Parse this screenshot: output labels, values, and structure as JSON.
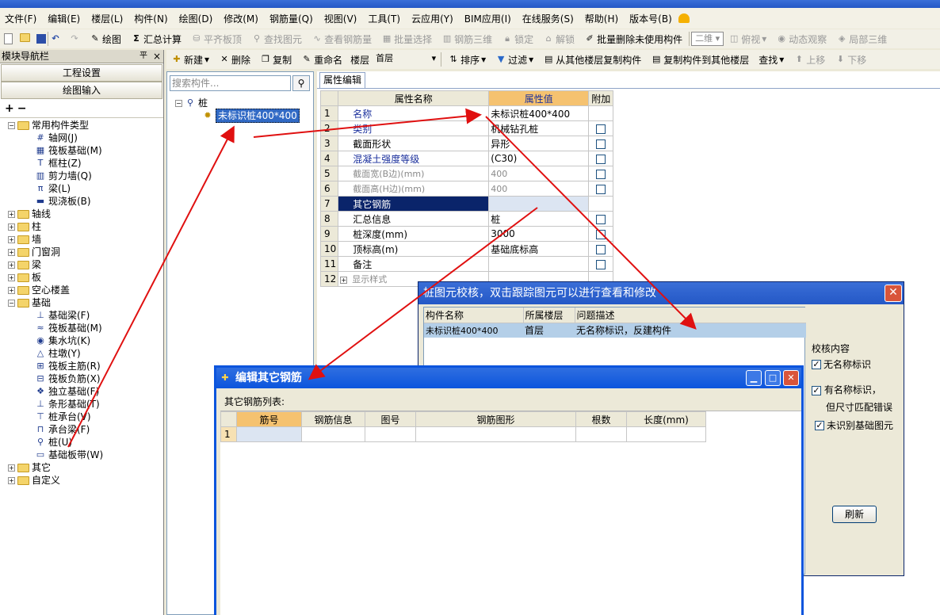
{
  "title_bar": {
    "text": ""
  },
  "menu": [
    "文件(F)",
    "编辑(E)",
    "楼层(L)",
    "构件(N)",
    "绘图(D)",
    "修改(M)",
    "钢筋量(Q)",
    "视图(V)",
    "工具(T)",
    "云应用(Y)",
    "BIM应用(I)",
    "在线服务(S)",
    "帮助(H)",
    "版本号(B)"
  ],
  "toolbar1": {
    "draw": "绘图",
    "sum_calc": "汇总计算",
    "flatten_slab": "平齐板顶",
    "find_element": "查找图元",
    "view_rebar": "查看钢筋量",
    "batch_select": "批量选择",
    "rebar_3d": "钢筋三维",
    "lock": "锁定",
    "unlock": "解锁",
    "batch_delete_unused": "批量删除未使用构件",
    "view_mode": "二维",
    "top_view": "俯视",
    "dynamic_observe": "动态观察",
    "local_3d": "局部三维"
  },
  "nav": {
    "title": "模块导航栏",
    "pin": "平",
    "close": "×",
    "project_settings": "工程设置",
    "drawing_input": "绘图输入",
    "tree": [
      {
        "label": "常用构件类型",
        "level": 0,
        "expanded": true
      },
      {
        "label": "轴网(J)",
        "level": 1
      },
      {
        "label": "筏板基础(M)",
        "level": 1
      },
      {
        "label": "框柱(Z)",
        "level": 1
      },
      {
        "label": "剪力墙(Q)",
        "level": 1
      },
      {
        "label": "梁(L)",
        "level": 1
      },
      {
        "label": "现浇板(B)",
        "level": 1
      },
      {
        "label": "轴线",
        "level": 0
      },
      {
        "label": "柱",
        "level": 0
      },
      {
        "label": "墙",
        "level": 0
      },
      {
        "label": "门窗洞",
        "level": 0
      },
      {
        "label": "梁",
        "level": 0
      },
      {
        "label": "板",
        "level": 0
      },
      {
        "label": "空心楼盖",
        "level": 0
      },
      {
        "label": "基础",
        "level": 0,
        "expanded": true
      },
      {
        "label": "基础梁(F)",
        "level": 1
      },
      {
        "label": "筏板基础(M)",
        "level": 1
      },
      {
        "label": "集水坑(K)",
        "level": 1
      },
      {
        "label": "柱墩(Y)",
        "level": 1
      },
      {
        "label": "筏板主筋(R)",
        "level": 1
      },
      {
        "label": "筏板负筋(X)",
        "level": 1
      },
      {
        "label": "独立基础(F)",
        "level": 1
      },
      {
        "label": "条形基础(T)",
        "level": 1
      },
      {
        "label": "桩承台(V)",
        "level": 1
      },
      {
        "label": "承台梁(F)",
        "level": 1
      },
      {
        "label": "桩(U)",
        "level": 1
      },
      {
        "label": "基础板带(W)",
        "level": 1
      },
      {
        "label": "其它",
        "level": 0
      },
      {
        "label": "自定义",
        "level": 0
      }
    ]
  },
  "toolbar2": {
    "new": "新建",
    "delete": "删除",
    "copy": "复制",
    "rename": "重命名",
    "floor_label": "楼层",
    "floor_value": "首层",
    "sort": "排序",
    "filter": "过滤",
    "copy_from_other": "从其他楼层复制构件",
    "copy_to_other": "复制构件到其他楼层",
    "find": "查找",
    "move_up": "上移",
    "move_down": "下移"
  },
  "component_list": {
    "search_placeholder": "搜索构件...",
    "root": "桩",
    "selected": "未标识桩400*400"
  },
  "property_editor": {
    "tab": "属性编辑",
    "headers": [
      "属性名称",
      "属性值",
      "附加"
    ],
    "rows": [
      {
        "num": "1",
        "name": "名称",
        "value": "未标识桩400*400",
        "check": false,
        "blue": true
      },
      {
        "num": "2",
        "name": "类别",
        "value": "机械钻孔桩",
        "check": true,
        "blue": true
      },
      {
        "num": "3",
        "name": "截面形状",
        "value": "异形",
        "check": true
      },
      {
        "num": "4",
        "name": "混凝土强度等级",
        "value": "(C30)",
        "check": true,
        "blue": true
      },
      {
        "num": "5",
        "name": "截面宽(B边)(mm)",
        "value": "400",
        "check": true,
        "gray": true
      },
      {
        "num": "6",
        "name": "截面高(H边)(mm)",
        "value": "400",
        "check": true,
        "gray": true
      },
      {
        "num": "7",
        "name": "其它钢筋",
        "value": "",
        "check": false,
        "selected": true
      },
      {
        "num": "8",
        "name": "汇总信息",
        "value": "桩",
        "check": true
      },
      {
        "num": "9",
        "name": "桩深度(mm)",
        "value": "3000",
        "check": true
      },
      {
        "num": "10",
        "name": "顶标高(m)",
        "value": "基础底标高",
        "check": true
      },
      {
        "num": "11",
        "name": "备注",
        "value": "",
        "check": true
      },
      {
        "num": "12",
        "name": "显示样式",
        "value": "",
        "check": false,
        "expander": true,
        "gray": true
      }
    ]
  },
  "validation_dialog": {
    "title": "桩图元校核，双击跟踪图元可以进行查看和修改",
    "headers": [
      "构件名称",
      "所属楼层",
      "问题描述"
    ],
    "rows": [
      {
        "name": "未标识桩400*400",
        "floor": "首层",
        "issue": "无名称标识，反建构件"
      }
    ],
    "section_label": "校核内容",
    "options": [
      {
        "label": "无名称标识",
        "checked": true
      },
      {
        "label": "有名称标识，",
        "label2": "但尺寸匹配错误",
        "checked": true
      },
      {
        "label": "未识别基础图元",
        "checked": true
      }
    ],
    "refresh": "刷新"
  },
  "rebar_dialog": {
    "title": "编辑其它钢筋",
    "list_label": "其它钢筋列表:",
    "headers": [
      "筋号",
      "钢筋信息",
      "图号",
      "钢筋图形",
      "根数",
      "长度(mm)"
    ],
    "row_num": "1"
  },
  "colors": {
    "title_blue": "#0c55dd",
    "annotation_red": "#e01010",
    "selected_row": "#0a246a",
    "prop_value_header": "#f5c270"
  }
}
